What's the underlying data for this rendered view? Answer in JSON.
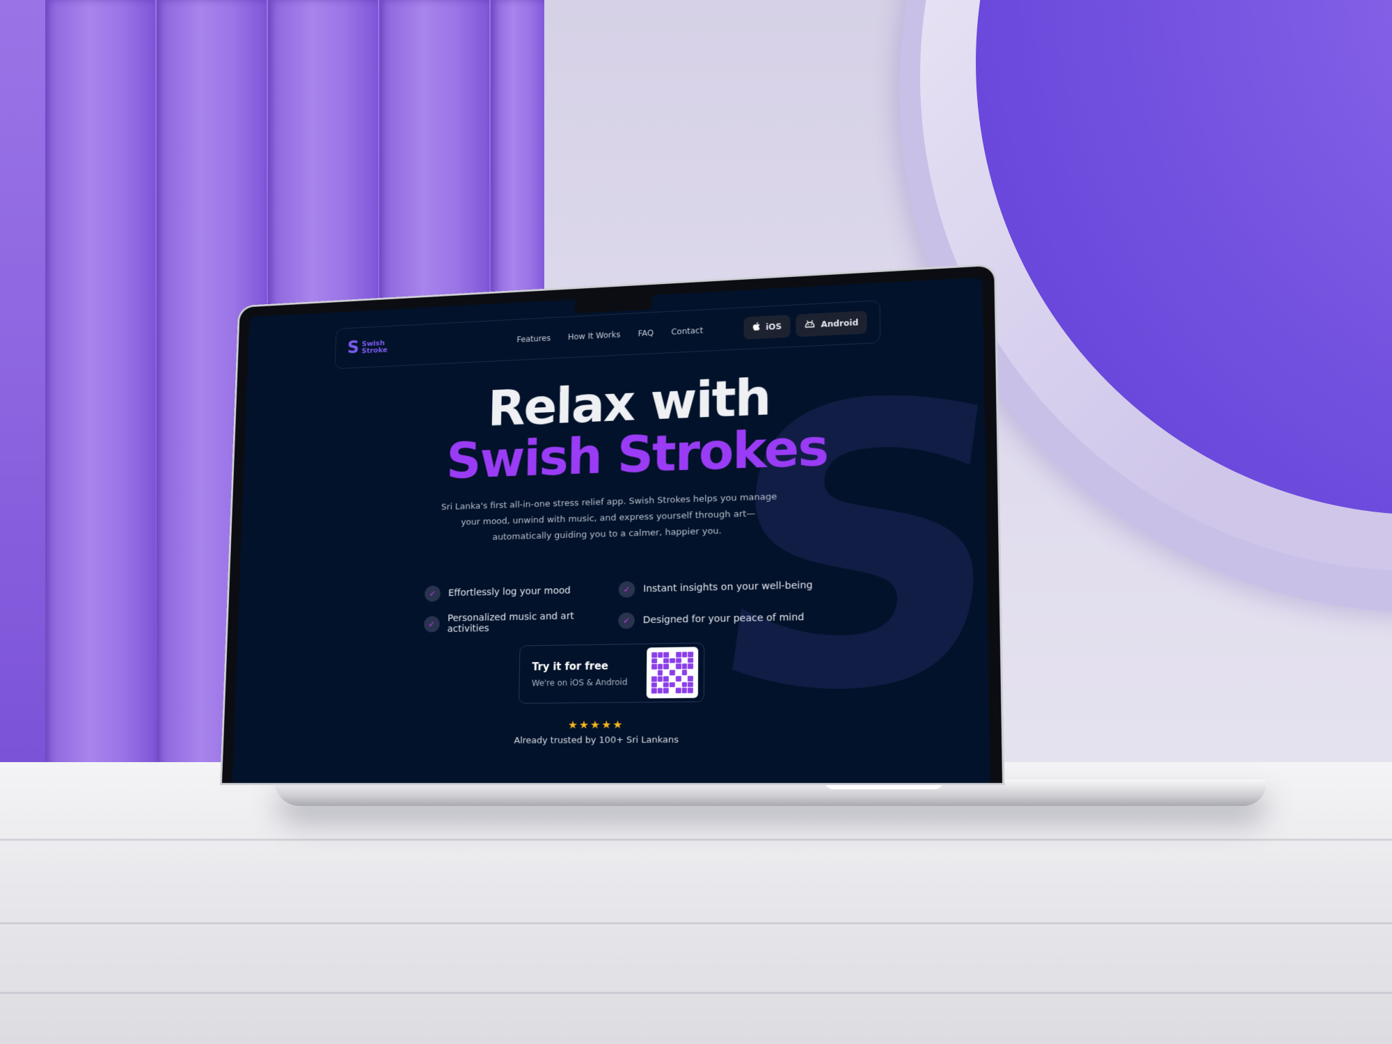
{
  "nav": {
    "logo_mark": "S",
    "logo_line1": "Swish",
    "logo_line2": "Stroke",
    "links": [
      "Features",
      "How It Works",
      "FAQ",
      "Contact"
    ],
    "buttons": [
      {
        "label": "iOS",
        "icon": "apple-icon"
      },
      {
        "label": "Android",
        "icon": "android-icon"
      }
    ]
  },
  "hero": {
    "title_line1": "Relax with",
    "title_line2": "Swish Strokes",
    "description": "Sri Lanka's first all-in-one stress relief app. Swish Strokes helps you manage your mood, unwind with music, and express yourself through art—automatically guiding you to a calmer, happier you.",
    "features": [
      "Effortlessly log your mood",
      "Instant insights on your well-being",
      "Personalized music and art activities",
      "Designed for your peace of mind"
    ]
  },
  "cta": {
    "title": "Try it for free",
    "subtitle": "We're on iOS & Android"
  },
  "rating": {
    "stars": "★★★★★",
    "trusted": "Already trusted by 100+ Sri Lankans"
  },
  "colors": {
    "accent": "#9a3cf5",
    "logo": "#7c5cf0",
    "background": "#02122a",
    "star": "#f6b81c"
  }
}
